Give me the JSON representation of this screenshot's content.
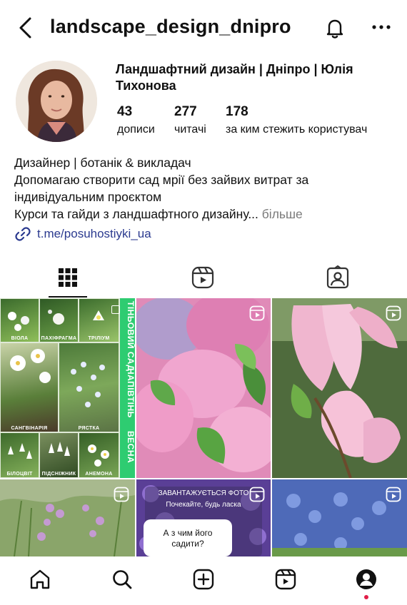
{
  "header": {
    "username": "landscape_design_dnipro"
  },
  "profile": {
    "name": "Ландшафтний дизайн | Дніпро | Юлія Тихонова",
    "stats": [
      {
        "value": "43",
        "label": "дописи"
      },
      {
        "value": "277",
        "label": "читачі"
      },
      {
        "value": "178",
        "label": "за ким стежить користувач"
      }
    ],
    "bio": {
      "line1": "Дизайнер | ботанік & викладач",
      "line2": "Допомагаю створити сад мрії без зайвих витрат за",
      "line3": "індивідуальним проєктом",
      "line4": "Курси та гайди з ландшафтного дизайну...",
      "more": "більше"
    },
    "link": "t.me/posuhostiyki_ua"
  },
  "tabs": [
    {
      "name": "grid-tab",
      "icon": "grid-icon",
      "active": true
    },
    {
      "name": "reels-tab",
      "icon": "reels-icon",
      "active": false
    },
    {
      "name": "tagged-tab",
      "icon": "tagged-icon",
      "active": false
    }
  ],
  "posts": {
    "collage": {
      "labels": [
        "ВІОЛА",
        "ПАХІФРАГМА",
        "ТРІЛІУМ",
        "САНГВІНАРІЯ",
        "РЯСТКА",
        "БІЛОЦВІТ",
        "ПІДСНІЖНИК",
        "АНЕМОНА"
      ],
      "band": [
        "ТІНЬОВИЙ САД",
        "НАПІВТІНЬ",
        "ВЕСНА"
      ]
    },
    "overlay_top_line1": "ЗАВАНТАЖУЄТЬСЯ ФОТО",
    "overlay_top_line2": "Почекайте, будь ласка",
    "overlay_card_line1": "А з чим його",
    "overlay_card_line2": "садити?"
  },
  "bottom_nav": [
    "home-icon",
    "search-icon",
    "create-icon",
    "reels-icon",
    "profile-icon"
  ],
  "colors": {
    "link": "#2b3a8f",
    "muted": "#7a7a7a",
    "band": "#2ecc71",
    "notification": "#e11d48"
  }
}
